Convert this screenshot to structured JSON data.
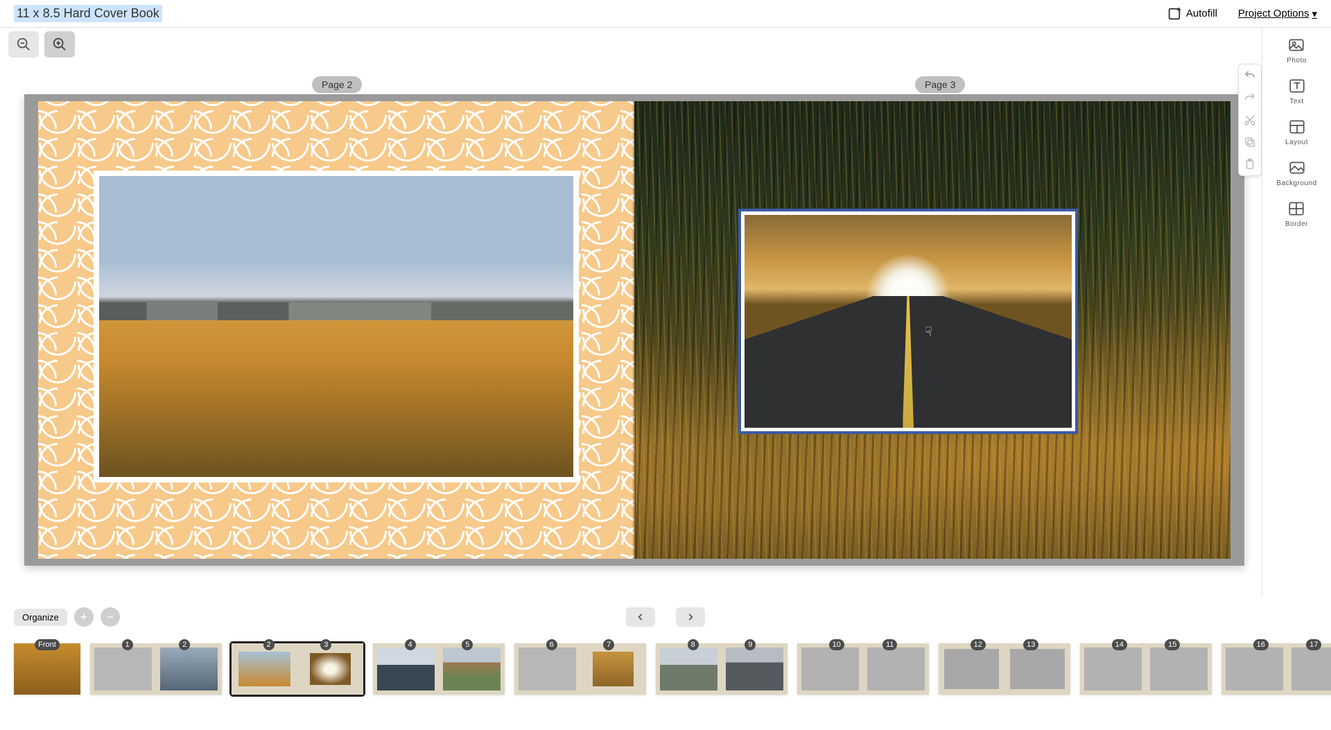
{
  "header": {
    "project_title": "11 x 8.5 Hard Cover Book",
    "autofill_label": "Autofill",
    "project_options_label": "Project Options"
  },
  "canvas": {
    "left_page_label": "Page 2",
    "right_page_label": "Page 3"
  },
  "right_panel": {
    "photo": "Photo",
    "text": "Text",
    "layout": "Layout",
    "background": "Background",
    "border": "Border"
  },
  "bottom": {
    "organize_label": "Organize"
  },
  "thumbnails": [
    {
      "type": "front",
      "label": "Front"
    },
    {
      "type": "spread",
      "left": "1",
      "right": "2",
      "selected": false,
      "style": "t1"
    },
    {
      "type": "spread",
      "left": "2",
      "right": "3",
      "selected": true,
      "style": "t2"
    },
    {
      "type": "spread",
      "left": "4",
      "right": "5",
      "selected": false,
      "style": "t3"
    },
    {
      "type": "spread",
      "left": "6",
      "right": "7",
      "selected": false,
      "style": "t4"
    },
    {
      "type": "spread",
      "left": "8",
      "right": "9",
      "selected": false,
      "style": "t5"
    },
    {
      "type": "spread",
      "left": "10",
      "right": "11",
      "selected": false,
      "style": "fblock"
    },
    {
      "type": "spread",
      "left": "12",
      "right": "13",
      "selected": false,
      "style": "fblock-alt"
    },
    {
      "type": "spread",
      "left": "14",
      "right": "15",
      "selected": false,
      "style": "fblock"
    },
    {
      "type": "spread",
      "left": "16",
      "right": "17",
      "selected": false,
      "style": "fblock"
    }
  ]
}
